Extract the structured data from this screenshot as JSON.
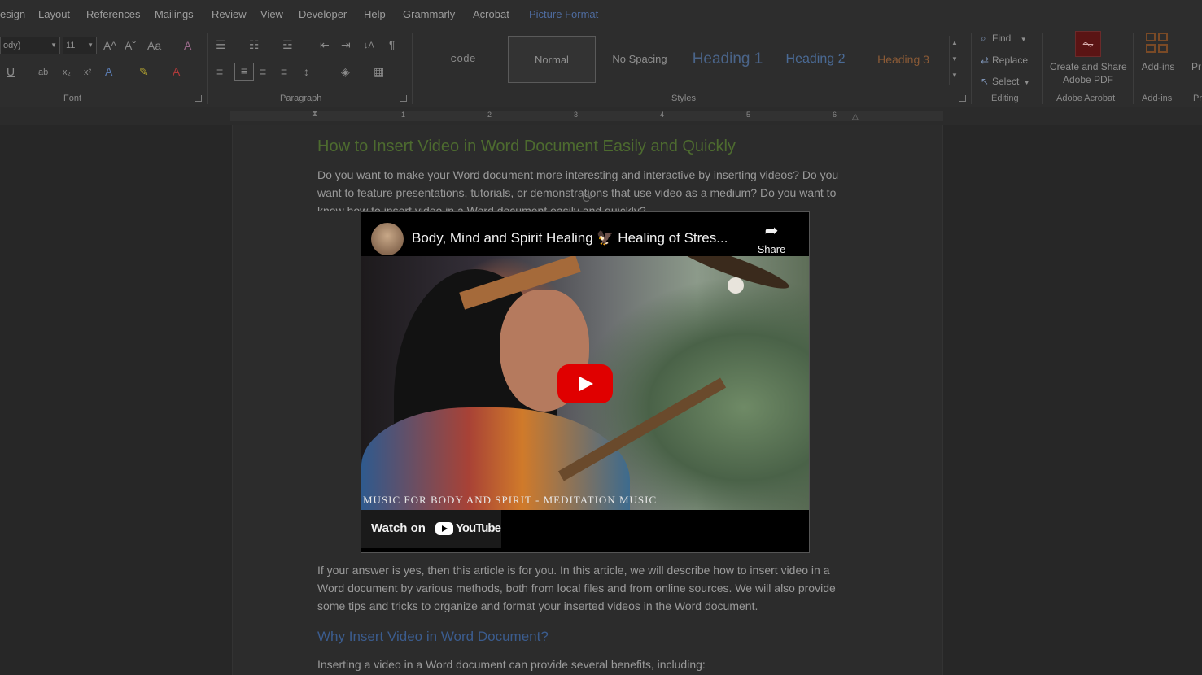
{
  "menu": {
    "tabs": [
      "esign",
      "Layout",
      "References",
      "Mailings",
      "Review",
      "View",
      "Developer",
      "Help",
      "Grammarly",
      "Acrobat",
      "Picture Format"
    ],
    "active": "Picture Format"
  },
  "ribbon": {
    "font": {
      "name_value": "ody)",
      "size_value": "11",
      "label": "Font",
      "grow_icon": "A^",
      "shrink_icon": "Aˇ",
      "case_icon": "Aa",
      "clear_icon": "A",
      "underline_icon": "U",
      "strike_icon": "ab",
      "subscript_icon": "x₂",
      "superscript_icon": "x²",
      "effects_icon": "A",
      "highlight_icon": "✎",
      "color_icon": "A"
    },
    "paragraph": {
      "label": "Paragraph",
      "bullets_icon": "☰",
      "numbering_icon": "☷",
      "multilevel_icon": "☲",
      "decrease_indent_icon": "⇤",
      "increase_indent_icon": "⇥",
      "sort_icon": "↓A",
      "pilcrow_icon": "¶",
      "align_left_icon": "≡",
      "align_center_icon": "≡",
      "align_right_icon": "≡",
      "justify_icon": "≡",
      "line_spacing_icon": "↕",
      "shading_icon": "◈",
      "borders_icon": "▦"
    },
    "styles": {
      "label": "Styles",
      "items": [
        "code",
        "Normal",
        "No Spacing",
        "Heading 1",
        "Heading 2",
        "Heading 3"
      ],
      "selected": "Normal"
    },
    "editing": {
      "label": "Editing",
      "find": "Find",
      "replace": "Replace",
      "select": "Select"
    },
    "acrobat": {
      "button_line1": "Create and Share",
      "button_line2": "Adobe PDF",
      "label": "Adobe Acrobat"
    },
    "addins": {
      "button": "Add-ins",
      "label": "Add-ins"
    },
    "overflow_button": "Pr",
    "overflow_label": "Pr"
  },
  "ruler": {
    "numbers": [
      "1",
      "2",
      "3",
      "4",
      "5",
      "6"
    ]
  },
  "document": {
    "title": "How to Insert Video in Word Document Easily and Quickly",
    "para1": "Do you want to make your Word document more interesting and interactive by inserting videos? Do you want to feature presentations, tutorials, or demonstrations that use video as a medium? Do you want to know how to insert video in a Word document easily and quickly?",
    "para2": "If your answer is yes, then this article is for you. In this article, we will describe how to insert video in a Word document by various methods, both from local files and from online sources. We will also provide some tips and tricks to organize and format your inserted videos in the Word document.",
    "heading2": "Why Insert Video in Word Document?",
    "para3": "Inserting a video in a Word document can provide several benefits, including:"
  },
  "video": {
    "title": "Body, Mind and Spirit Healing 🦅 Healing of Stres...",
    "share": "Share",
    "caption": "MUSIC FOR BODY AND SPIRIT - MEDITATION MUSIC",
    "watch_on": "Watch on",
    "youtube": "YouTube"
  },
  "colors": {
    "title_green": "#4d6b2f",
    "heading_blue": "#3b5c8e",
    "play_red": "#e00000",
    "active_tab": "#4e6b9e"
  }
}
